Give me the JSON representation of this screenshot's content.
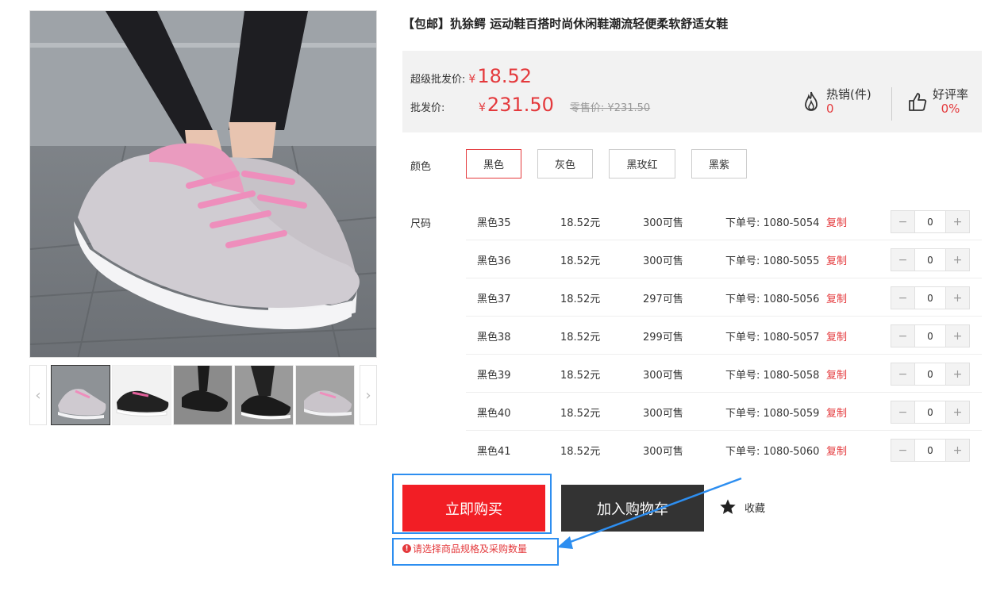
{
  "product": {
    "title": "【包邮】犰狳鳄 运动鞋百搭时尚休闲鞋潮流轻便柔软舒适女鞋"
  },
  "gallery": {
    "prev_icon": "chevron-left-icon",
    "next_icon": "chevron-right-icon",
    "thumbnail_count": 5,
    "active_thumbnail": 1
  },
  "pricing": {
    "super_label": "超级批发价:",
    "super_currency": "¥",
    "super_price": "18.52",
    "wholesale_label": "批发价:",
    "wholesale_currency": "¥",
    "wholesale_price": "231.50",
    "retail_text": "零售价: ¥231.50"
  },
  "stats": {
    "sales_label": "热销(件)",
    "sales_value": "0",
    "sales_icon": "flame-icon",
    "rating_label": "好评率",
    "rating_value": "0%",
    "rating_icon": "thumbs-up-icon"
  },
  "color": {
    "label": "颜色",
    "options": [
      {
        "label": "黑色",
        "selected": true
      },
      {
        "label": "灰色",
        "selected": false
      },
      {
        "label": "黑玫红",
        "selected": false
      },
      {
        "label": "黑紫",
        "selected": false
      }
    ]
  },
  "sizes": {
    "label": "尺码",
    "copy_label": "复制",
    "rows": [
      {
        "name": "黑色35",
        "price": "18.52元",
        "stock": "300可售",
        "order": "下单号: 1080-5054",
        "qty": "0"
      },
      {
        "name": "黑色36",
        "price": "18.52元",
        "stock": "300可售",
        "order": "下单号: 1080-5055",
        "qty": "0"
      },
      {
        "name": "黑色37",
        "price": "18.52元",
        "stock": "297可售",
        "order": "下单号: 1080-5056",
        "qty": "0"
      },
      {
        "name": "黑色38",
        "price": "18.52元",
        "stock": "299可售",
        "order": "下单号: 1080-5057",
        "qty": "0"
      },
      {
        "name": "黑色39",
        "price": "18.52元",
        "stock": "300可售",
        "order": "下单号: 1080-5058",
        "qty": "0"
      },
      {
        "name": "黑色40",
        "price": "18.52元",
        "stock": "300可售",
        "order": "下单号: 1080-5059",
        "qty": "0"
      },
      {
        "name": "黑色41",
        "price": "18.52元",
        "stock": "300可售",
        "order": "下单号: 1080-5060",
        "qty": "0"
      }
    ],
    "minus": "−",
    "plus": "+"
  },
  "actions": {
    "buy_now": "立即购买",
    "add_to_cart": "加入购物车",
    "favorite": "收藏",
    "favorite_icon": "star-icon"
  },
  "warning": {
    "icon": "!",
    "text": "请选择商品规格及采购数量"
  },
  "colors": {
    "accent_red": "#e4393c",
    "buy_red": "#f21e25",
    "cart_dark": "#333333",
    "annotation_blue": "#2d8ef0"
  }
}
